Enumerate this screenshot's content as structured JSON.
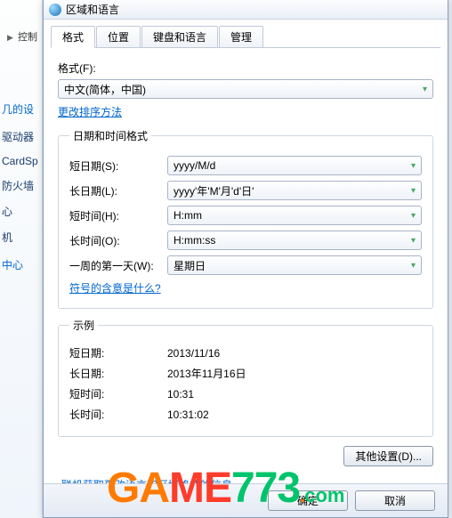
{
  "breadcrumb": {
    "item": "控制"
  },
  "sidebar": {
    "heading": "几的设",
    "items": [
      "驱动器",
      "CardSp",
      "防火墙",
      "心",
      "机",
      "中心"
    ]
  },
  "dialog": {
    "title": "区域和语言",
    "tabs": [
      "格式",
      "位置",
      "键盘和语言",
      "管理"
    ],
    "active_tab": 0
  },
  "format": {
    "label": "格式(F):",
    "value": "中文(简体，中国)",
    "sort_link": "更改排序方法"
  },
  "datetime_group": {
    "legend": "日期和时间格式",
    "rows": [
      {
        "label": "短日期(S):",
        "value": "yyyy/M/d"
      },
      {
        "label": "长日期(L):",
        "value": "yyyy'年'M'月'd'日'"
      },
      {
        "label": "短时间(H):",
        "value": "H:mm"
      },
      {
        "label": "长时间(O):",
        "value": "H:mm:ss"
      },
      {
        "label": "一周的第一天(W):",
        "value": "星期日"
      }
    ],
    "notation_link": "符号的含意是什么?"
  },
  "example_group": {
    "legend": "示例",
    "rows": [
      {
        "label": "短日期:",
        "value": "2013/11/16"
      },
      {
        "label": "长日期:",
        "value": "2013年11月16日"
      },
      {
        "label": "短时间:",
        "value": "10:31"
      },
      {
        "label": "长时间:",
        "value": "10:31:02"
      }
    ]
  },
  "buttons": {
    "other": "其他设置(D)...",
    "online_link": "联机获取更改语言和区域格式的信息",
    "ok": "确定",
    "cancel": "取消"
  },
  "watermark": {
    "text": "GAME773",
    "suffix": ".com"
  }
}
